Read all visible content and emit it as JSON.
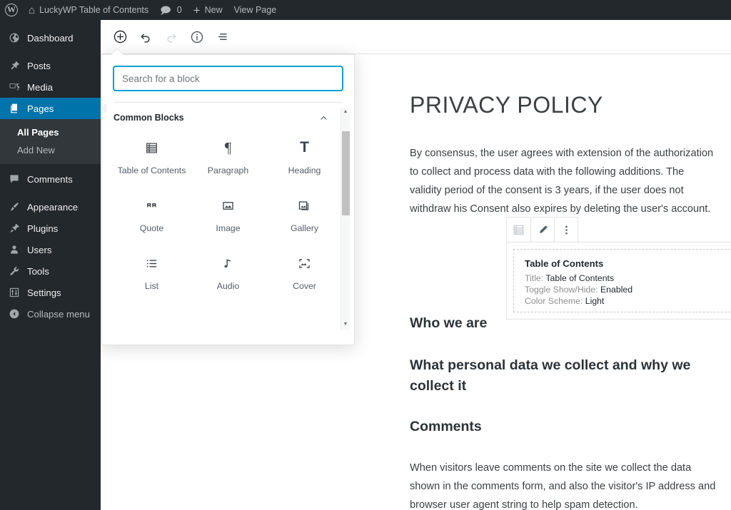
{
  "adminbar": {
    "wp_logo": "wordpress-logo",
    "site_name": "LuckyWP Table of Contents",
    "comments_count": "0",
    "new_label": "New",
    "view_page_label": "View Page"
  },
  "sidebar": {
    "items": [
      {
        "label": "Dashboard",
        "icon": "dashboard-icon",
        "current": false
      },
      {
        "label": "Posts",
        "icon": "pin-icon",
        "current": false
      },
      {
        "label": "Media",
        "icon": "media-icon",
        "current": false
      },
      {
        "label": "Pages",
        "icon": "pages-icon",
        "current": true
      },
      {
        "label": "Comments",
        "icon": "comment-icon",
        "current": false
      },
      {
        "label": "Appearance",
        "icon": "brush-icon",
        "current": false
      },
      {
        "label": "Plugins",
        "icon": "plugin-icon",
        "current": false
      },
      {
        "label": "Users",
        "icon": "user-icon",
        "current": false
      },
      {
        "label": "Tools",
        "icon": "wrench-icon",
        "current": false
      },
      {
        "label": "Settings",
        "icon": "settings-icon",
        "current": false
      },
      {
        "label": "Collapse menu",
        "icon": "collapse-icon",
        "current": false
      }
    ],
    "submenu": [
      {
        "label": "All Pages",
        "current": true
      },
      {
        "label": "Add New",
        "current": false
      }
    ]
  },
  "editor_toolbar": {
    "buttons": [
      {
        "name": "add-block-button",
        "icon": "plus-circle-icon",
        "disabled": false
      },
      {
        "name": "undo-button",
        "icon": "undo-icon",
        "disabled": false
      },
      {
        "name": "redo-button",
        "icon": "redo-icon",
        "disabled": true
      },
      {
        "name": "content-info-button",
        "icon": "info-circle-icon",
        "disabled": false
      },
      {
        "name": "block-navigation-button",
        "icon": "list-view-icon",
        "disabled": false
      }
    ]
  },
  "inserter": {
    "search_placeholder": "Search for a block",
    "search_value": "",
    "panel_title": "Common Blocks",
    "collapse_icon": "chevron-up-icon",
    "blocks": [
      {
        "label": "Table of Contents",
        "icon": "table-of-contents-icon"
      },
      {
        "label": "Paragraph",
        "icon": "pilcrow-icon"
      },
      {
        "label": "Heading",
        "icon": "heading-t-icon"
      },
      {
        "label": "Quote",
        "icon": "quote-icon"
      },
      {
        "label": "Image",
        "icon": "image-icon"
      },
      {
        "label": "Gallery",
        "icon": "gallery-icon"
      },
      {
        "label": "List",
        "icon": "list-icon"
      },
      {
        "label": "Audio",
        "icon": "audio-note-icon"
      },
      {
        "label": "Cover",
        "icon": "cover-icon"
      }
    ],
    "scrollbar": {
      "up_arrow": "▲",
      "down_arrow": "▼"
    }
  },
  "block_toolbar": {
    "buttons": [
      {
        "name": "block-type-button",
        "icon": "toc-block-icon"
      },
      {
        "name": "edit-pencil-button",
        "icon": "pencil-icon"
      },
      {
        "name": "more-options-button",
        "icon": "ellipsis-vertical-icon"
      }
    ]
  },
  "post": {
    "title": "Privacy Policy",
    "intro_paragraph": "By consensus, the user agrees with extension of the authorization to collect and process data with the following additions. The validity period of the consent is 3 years, if the user does not withdraw his Consent also expires by deleting the user's account.",
    "toc_block": {
      "heading": "Table of Contents",
      "rows": [
        {
          "label": "Title:",
          "value": "Table of Contents"
        },
        {
          "label": "Toggle Show/Hide:",
          "value": "Enabled"
        },
        {
          "label": "Color Scheme:",
          "value": "Light"
        }
      ]
    },
    "heading_1": "Who we are",
    "heading_2": "What personal data we collect and why we collect it",
    "heading_3": "Comments",
    "paragraph_2": "When visitors leave comments on the site we collect the data shown in the comments form, and also the visitor's IP address and browser user agent string to help spam detection."
  },
  "colors": {
    "admin_dark": "#23282d",
    "admin_submenu": "#32373c",
    "accent_blue": "#0073aa",
    "focus_blue": "#00a0d2",
    "border_grey": "#e2e4e7"
  }
}
